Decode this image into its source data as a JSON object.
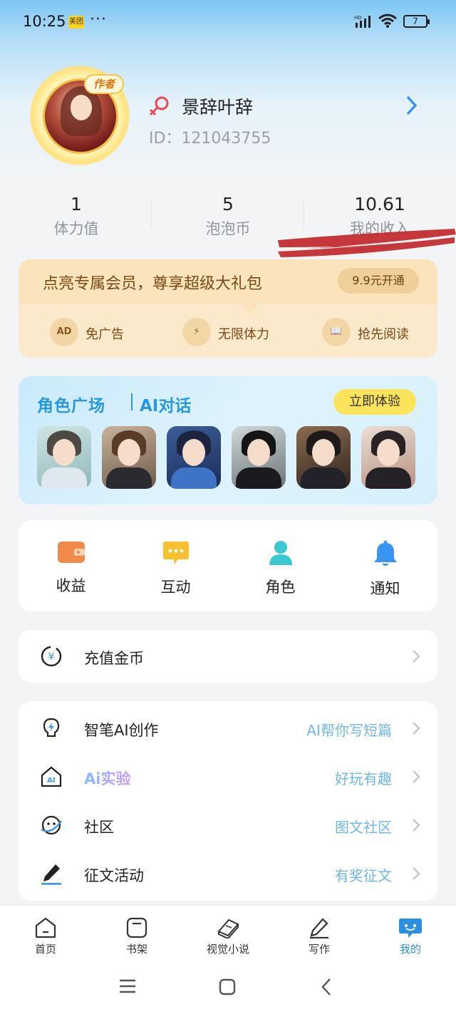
{
  "status_bar": {
    "time": "10:25",
    "app_badge": "美团",
    "more": "···",
    "battery": "7"
  },
  "profile": {
    "author_tag": "作者",
    "username": "景辞叶辞",
    "id_text": "ID：121043755"
  },
  "stats": [
    {
      "value": "1",
      "label": "体力值"
    },
    {
      "value": "5",
      "label": "泡泡币"
    },
    {
      "value": "10.61",
      "label": "我的收入"
    }
  ],
  "vip": {
    "title": "点亮专属会员，尊享超级大礼包",
    "button": "9.9元开通",
    "perks": [
      {
        "icon": "AD",
        "label": "免广告"
      },
      {
        "icon": "⚡",
        "label": "无限体力"
      },
      {
        "icon": "📖",
        "label": "抢先阅读"
      }
    ]
  },
  "role": {
    "title": "角色广场",
    "subtitle": "AI对话",
    "button": "立即体验"
  },
  "quick": [
    {
      "label": "收益",
      "icon": "wallet-icon",
      "color": "#f08a4b"
    },
    {
      "label": "互动",
      "icon": "chat-icon",
      "color": "#f7c02e"
    },
    {
      "label": "角色",
      "icon": "person-icon",
      "color": "#3dc7d3"
    },
    {
      "label": "通知",
      "icon": "bell-icon",
      "color": "#3a95f0"
    }
  ],
  "recharge": {
    "label": "充值金币"
  },
  "menu": [
    {
      "label": "智笔AI创作",
      "sub": "AI帮你写短篇"
    },
    {
      "label": "Ai实验",
      "sub": "好玩有趣"
    },
    {
      "label": "社区",
      "sub": "图文社区"
    },
    {
      "label": "征文活动",
      "sub": "有奖征文"
    }
  ],
  "nav": [
    {
      "label": "首页"
    },
    {
      "label": "书架"
    },
    {
      "label": "视觉小说"
    },
    {
      "label": "写作"
    },
    {
      "label": "我的"
    }
  ]
}
